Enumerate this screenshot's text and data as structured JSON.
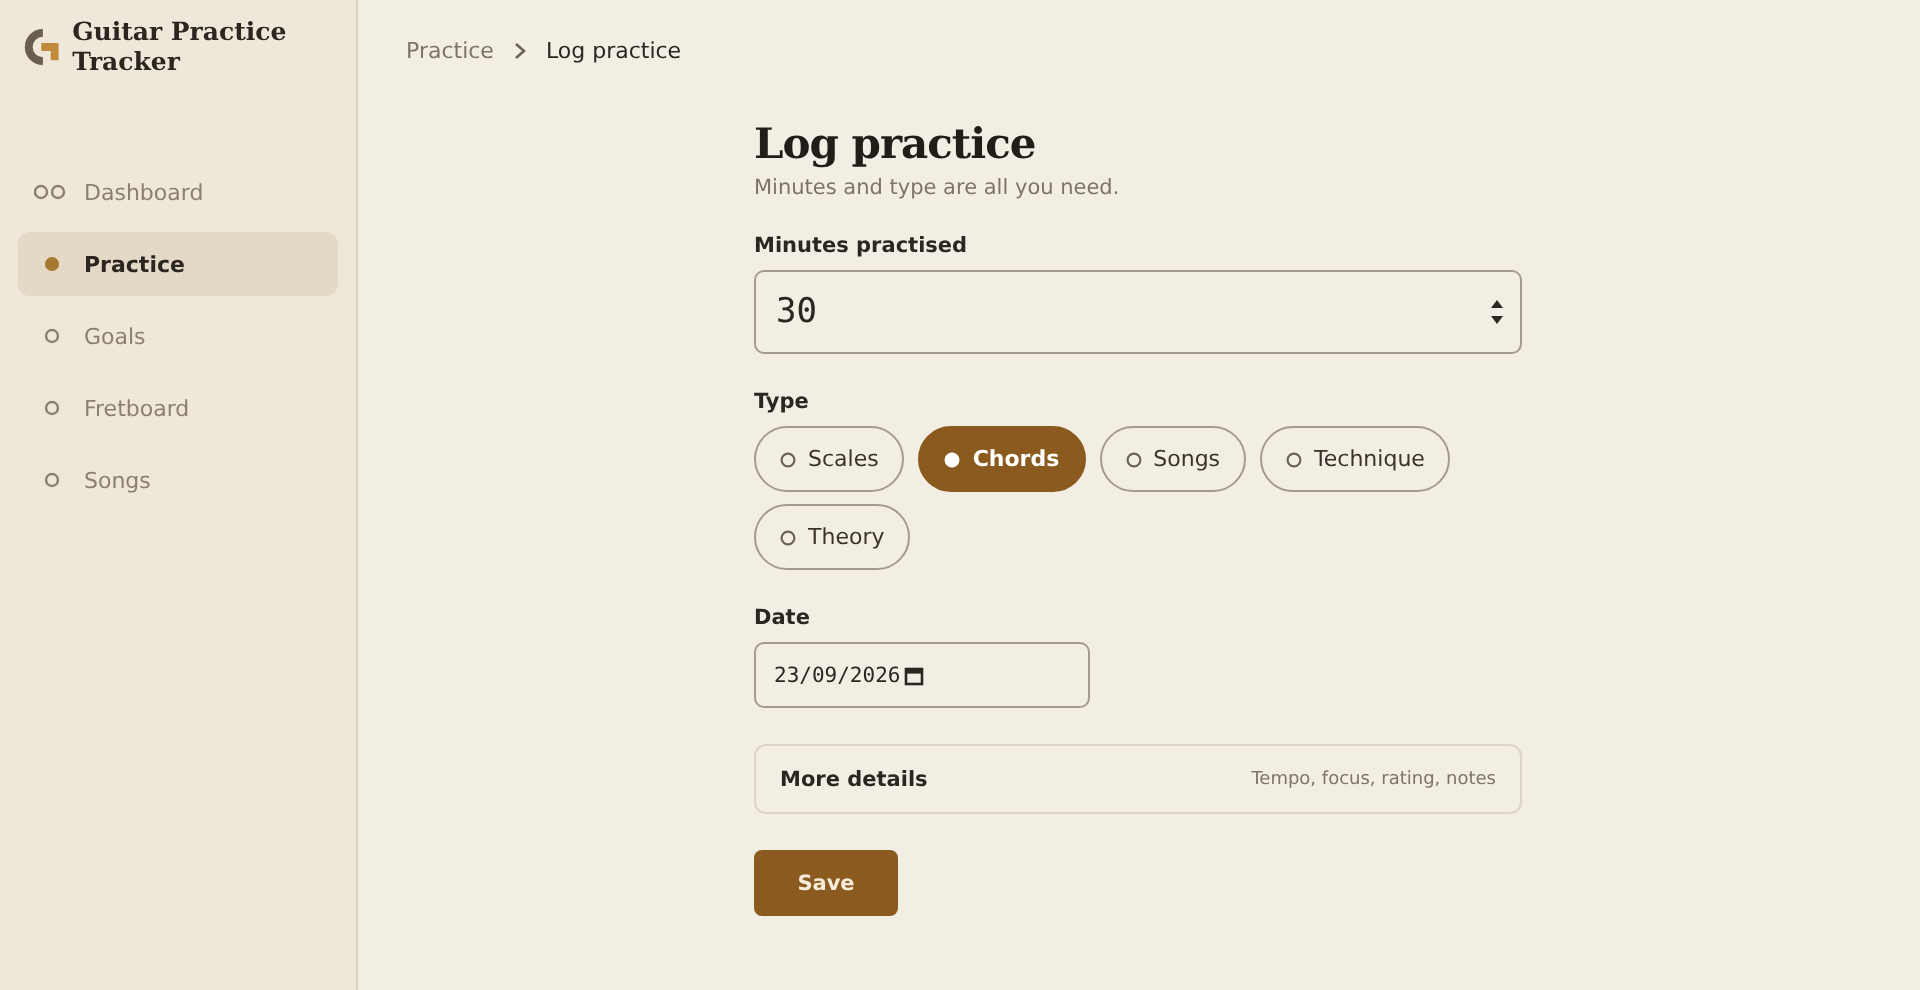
{
  "app": {
    "title": "Guitar Practice Tracker"
  },
  "sidebar": {
    "items": [
      {
        "label": "Dashboard",
        "kind": "overview",
        "selected": false
      },
      {
        "label": "Practice",
        "kind": "page",
        "selected": true
      },
      {
        "label": "Goals",
        "kind": "page",
        "selected": false
      },
      {
        "label": "Fretboard",
        "kind": "page",
        "selected": false
      },
      {
        "label": "Songs",
        "kind": "page",
        "selected": false
      }
    ]
  },
  "breadcrumb": [
    {
      "label": "Practice"
    },
    {
      "label": "Log practice"
    }
  ],
  "form": {
    "title": "Log practice",
    "subtitle": "Minutes and type are all you need.",
    "minutes": {
      "label": "Minutes practised",
      "value": "30"
    },
    "type": {
      "label": "Type",
      "options": [
        {
          "label": "Scales",
          "selected": false
        },
        {
          "label": "Chords",
          "selected": true
        },
        {
          "label": "Songs",
          "selected": false
        },
        {
          "label": "Technique",
          "selected": false
        },
        {
          "label": "Theory",
          "selected": false
        }
      ]
    },
    "date": {
      "label": "Date",
      "value": "23/09/2026"
    },
    "details": {
      "label": "More details",
      "hint": "Tempo, focus, rating, notes",
      "expanded": false
    },
    "save": "Save"
  }
}
